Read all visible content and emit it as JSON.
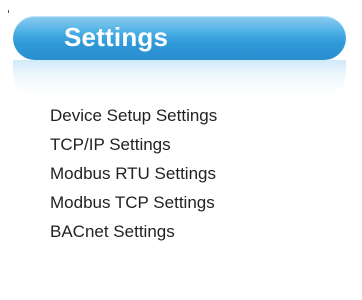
{
  "panel": {
    "title": "Settings",
    "links": [
      {
        "label": "Device Setup Settings"
      },
      {
        "label": "TCP/IP Settings"
      },
      {
        "label": "Modbus RTU Settings"
      },
      {
        "label": "Modbus TCP Settings"
      },
      {
        "label": "BACnet Settings"
      }
    ]
  },
  "colors": {
    "header_gradient_top": "#8dcdf0",
    "header_gradient_bottom": "#2a8ed0",
    "title_text": "#ffffff",
    "link_text": "#222222"
  }
}
